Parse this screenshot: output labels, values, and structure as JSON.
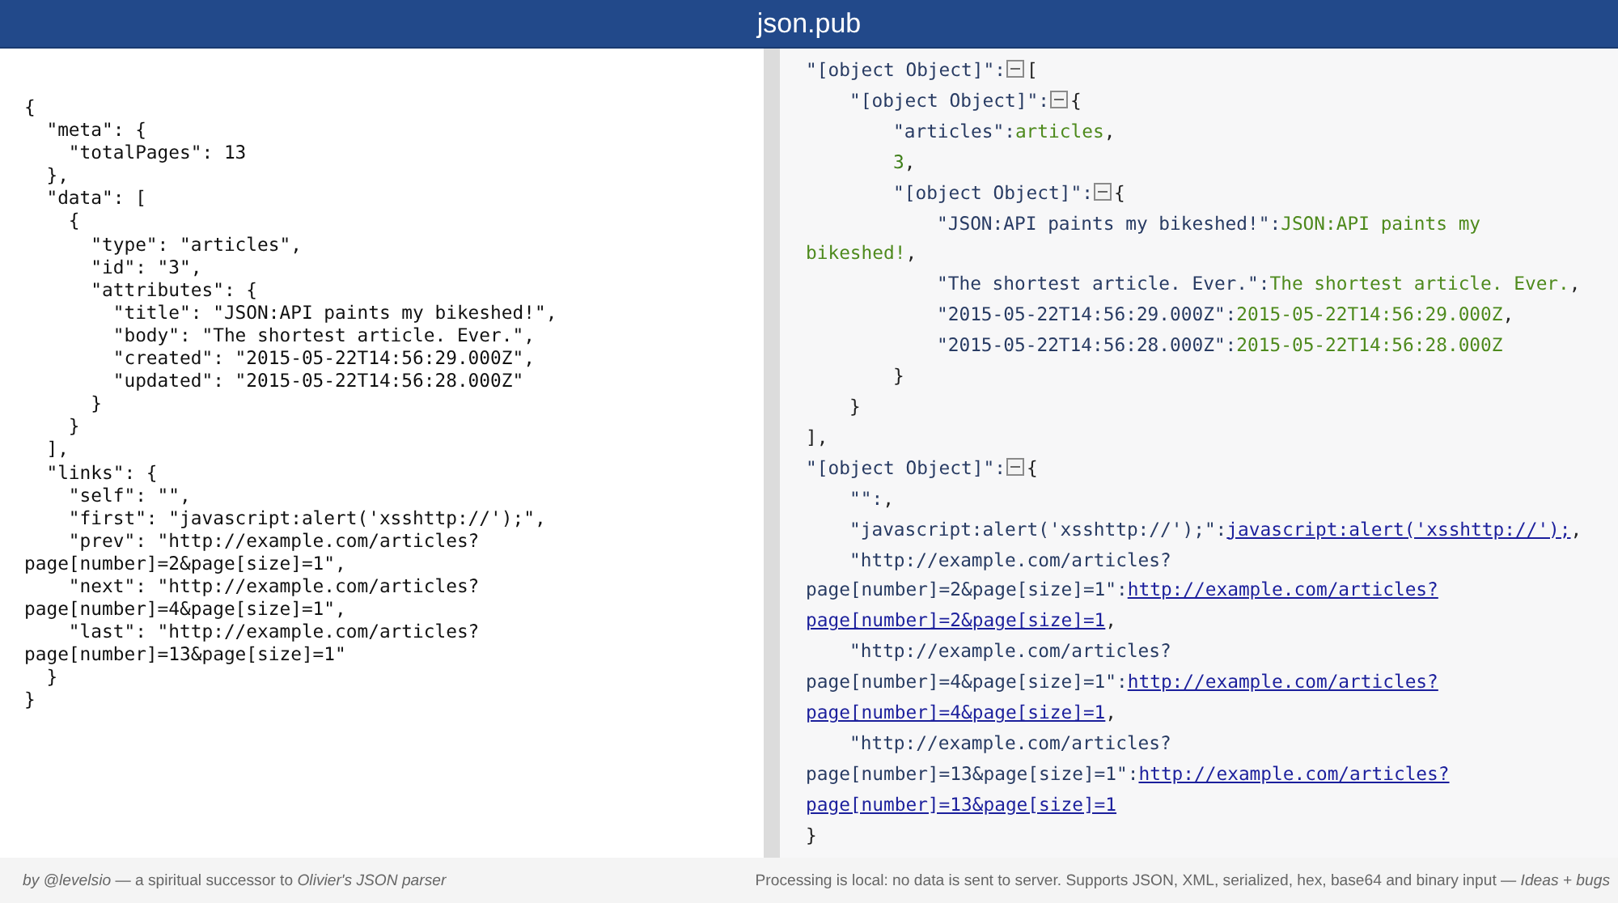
{
  "header": {
    "title": "json.pub"
  },
  "input": {
    "lines": [
      "{",
      "  \"meta\": {",
      "    \"totalPages\": 13",
      "  },",
      "  \"data\": [",
      "    {",
      "      \"type\": \"articles\",",
      "      \"id\": \"3\",",
      "      \"attributes\": {",
      "        \"title\": \"JSON:API paints my bikeshed!\",",
      "        \"body\": \"The shortest article. Ever.\",",
      "        \"created\": \"2015-05-22T14:56:29.000Z\",",
      "        \"updated\": \"2015-05-22T14:56:28.000Z\"",
      "      }",
      "    }",
      "  ],",
      "  \"links\": {",
      "    \"self\": \"\",",
      "    \"first\": \"javascript:alert('xsshttp://');\",",
      "    \"prev\": \"http://example.com/articles?",
      "page[number]=2&page[size]=1\",",
      "    \"next\": \"http://example.com/articles?",
      "page[number]=4&page[size]=1\",",
      "    \"last\": \"http://example.com/articles?",
      "page[number]=13&page[size]=1\"",
      "  }",
      "}"
    ]
  },
  "tree": [
    {
      "key": [
        "\"[object Object]\":"
      ],
      "opener": "[",
      "expanded": true,
      "close": "],",
      "children": [
        {
          "key": [
            "\"[object Object]\":"
          ],
          "opener": "{",
          "expanded": true,
          "close": "}",
          "children": [
            {
              "key": [
                "\"articles\":"
              ],
              "value": [
                "articles"
              ],
              "kind": "string",
              "suffix": ","
            },
            {
              "value": [
                "3"
              ],
              "kind": "number",
              "suffix": ","
            },
            {
              "key": [
                "\"[object Object]\":"
              ],
              "opener": "{",
              "expanded": true,
              "close": "}",
              "children": [
                {
                  "key": [
                    "\"JSON:API paints my bikeshed!\":"
                  ],
                  "value": [
                    "JSON:API paints my",
                    "bikeshed!"
                  ],
                  "kind": "string",
                  "suffix": ","
                },
                {
                  "key": [
                    "\"The shortest article. Ever.\":"
                  ],
                  "value": [
                    "The shortest article. Ever."
                  ],
                  "kind": "string",
                  "suffix": ","
                },
                {
                  "key": [
                    "\"2015-05-22T14:56:29.000Z\":"
                  ],
                  "value": [
                    "2015-05-22T14:56:29.000Z"
                  ],
                  "kind": "string",
                  "suffix": ","
                },
                {
                  "key": [
                    "\"2015-05-22T14:56:28.000Z\":"
                  ],
                  "value": [
                    "2015-05-22T14:56:28.000Z"
                  ],
                  "kind": "string"
                }
              ]
            }
          ]
        }
      ]
    },
    {
      "key": [
        "\"[object Object]\":"
      ],
      "opener": "{",
      "expanded": true,
      "close": "}",
      "children": [
        {
          "key": [
            "\"\":"
          ],
          "suffix": ","
        },
        {
          "key": [
            "\"javascript:alert('xsshttp://');\":"
          ],
          "value": [
            "javascript:alert('xsshttp://');"
          ],
          "kind": "link",
          "suffix": ","
        },
        {
          "key": [
            "\"http://example.com/articles?",
            "page[number]=2&page[size]=1\":"
          ],
          "value": [
            "http://example.com/articles?",
            "page[number]=2&page[size]=1"
          ],
          "kind": "link",
          "suffix": ","
        },
        {
          "key": [
            "\"http://example.com/articles?",
            "page[number]=4&page[size]=1\":"
          ],
          "value": [
            "http://example.com/articles?",
            "page[number]=4&page[size]=1"
          ],
          "kind": "link",
          "suffix": ","
        },
        {
          "key": [
            "\"http://example.com/articles?",
            "page[number]=13&page[size]=1\":"
          ],
          "value": [
            "http://example.com/articles?",
            "page[number]=13&page[size]=1"
          ],
          "kind": "link"
        }
      ]
    }
  ],
  "footer": {
    "credit": "*by @levelsio* — a spiritual successor to *Olivier's JSON parser*",
    "info": "Processing is local: no data is sent to server. Supports JSON, XML, serialized, hex, base64 and binary input — *Ideas + bugs*"
  }
}
